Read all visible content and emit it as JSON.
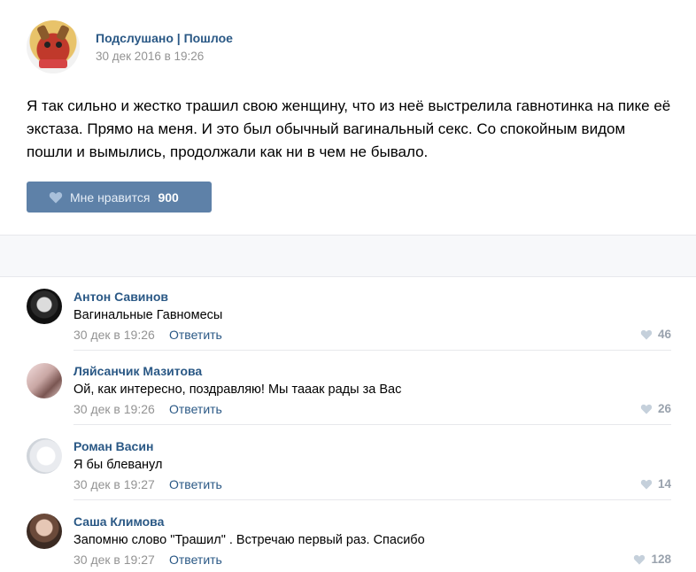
{
  "post": {
    "group_name": "Подслушано | Пошлое",
    "date": "30 дек 2016 в 19:26",
    "text": "Я так сильно и жестко трашил свою женщину, что из неё выстрелила гавнотинка на пике её экстаза. Прямо на меня. И это был обычный вагинальный секс. Со спокойным видом пошли и вымылись, продолжали как ни в чем не бывало.",
    "like_label": "Мне нравится",
    "like_count": "900"
  },
  "comments": [
    {
      "author": "Антон Савинов",
      "text": "Вагинальные Гавномесы",
      "date": "30 дек в 19:26",
      "reply": "Ответить",
      "likes": "46"
    },
    {
      "author": "Ляйсанчик Мазитова",
      "text": "Ой, как интересно, поздравляю! Мы тааак рады за Вас",
      "date": "30 дек в 19:26",
      "reply": "Ответить",
      "likes": "26"
    },
    {
      "author": "Роман Васин",
      "text": "Я бы блеванул",
      "date": "30 дек в 19:27",
      "reply": "Ответить",
      "likes": "14"
    },
    {
      "author": "Саша Климова",
      "text": "Запомню слово \"Трашил\" . Встречаю первый раз. Спасибо",
      "date": "30 дек в 19:27",
      "reply": "Ответить",
      "likes": "128"
    }
  ],
  "colors": {
    "link": "#2a5885",
    "button": "#5e81a8",
    "muted": "#939393",
    "like_count": "#99a2ad"
  }
}
